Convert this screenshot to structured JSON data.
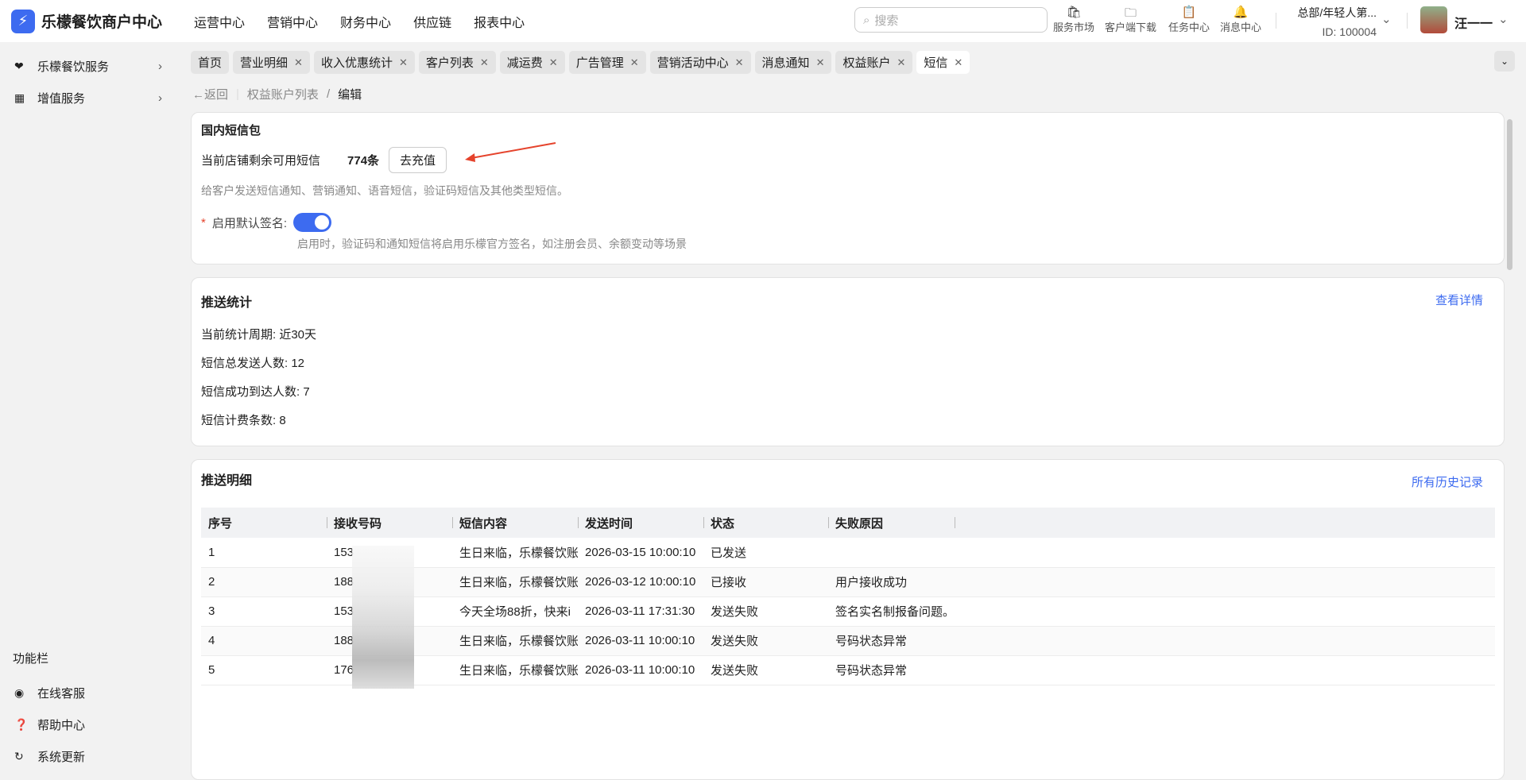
{
  "header": {
    "brand": "乐檬餐饮商户中心",
    "nav": [
      "运营中心",
      "营销中心",
      "财务中心",
      "供应链",
      "报表中心"
    ],
    "search_placeholder": "搜索",
    "tools": [
      "服务市场",
      "客户端下载",
      "任务中心",
      "消息中心"
    ],
    "org": "总部/年轻人第...",
    "org_id": "ID: 100004",
    "user": "汪一一"
  },
  "sidebar": {
    "items": [
      "乐檬餐饮服务",
      "增值服务"
    ],
    "section": "功能栏",
    "bottom": [
      "在线客服",
      "帮助中心",
      "系统更新"
    ]
  },
  "tabs": [
    "首页",
    "营业明细",
    "收入优惠统计",
    "客户列表",
    "减运费",
    "广告管理",
    "营销活动中心",
    "消息通知",
    "权益账户",
    "短信"
  ],
  "breadcrumb": {
    "back": "返回",
    "parent": "权益账户列表",
    "current": "编辑"
  },
  "package": {
    "title": "国内短信包",
    "remain_label": "当前店铺剩余可用短信",
    "remain_value": "774条",
    "recharge": "去充值",
    "desc": "给客户发送短信通知、营销通知、语音短信，验证码短信及其他类型短信。",
    "sign_label": "启用默认签名:",
    "sign_enabled": true,
    "sign_hint": "启用时，验证码和通知短信将启用乐檬官方签名，如注册会员、余额变动等场景"
  },
  "stats": {
    "title": "推送统计",
    "link": "查看详情",
    "period": "当前统计周期:  近30天",
    "total": "短信总发送人数:  12",
    "success": "短信成功到达人数:  7",
    "billed": "短信计费条数:  8"
  },
  "detail": {
    "title": "推送明细",
    "link": "所有历史记录",
    "columns": [
      "序号",
      "接收号码",
      "短信内容",
      "发送时间",
      "状态",
      "失败原因"
    ],
    "rows": [
      [
        "1",
        "153",
        "生日来临，乐檬餐饮账",
        "2026-03-15 10:00:10",
        "已发送",
        ""
      ],
      [
        "2",
        "188",
        "生日来临，乐檬餐饮账",
        "2026-03-12 10:00:10",
        "已接收",
        "用户接收成功"
      ],
      [
        "3",
        "153",
        "今天全场88折，快来i",
        "2026-03-11 17:31:30",
        "发送失败",
        "签名实名制报备问题。"
      ],
      [
        "4",
        "188",
        "生日来临，乐檬餐饮账",
        "2026-03-11 10:00:10",
        "发送失败",
        "号码状态异常"
      ],
      [
        "5",
        "176",
        "生日来临，乐檬餐饮账",
        "2026-03-11 10:00:10",
        "发送失败",
        "号码状态异常"
      ]
    ]
  },
  "colors": {
    "accent": "#3d6bf0",
    "arrow": "#e5432c"
  }
}
